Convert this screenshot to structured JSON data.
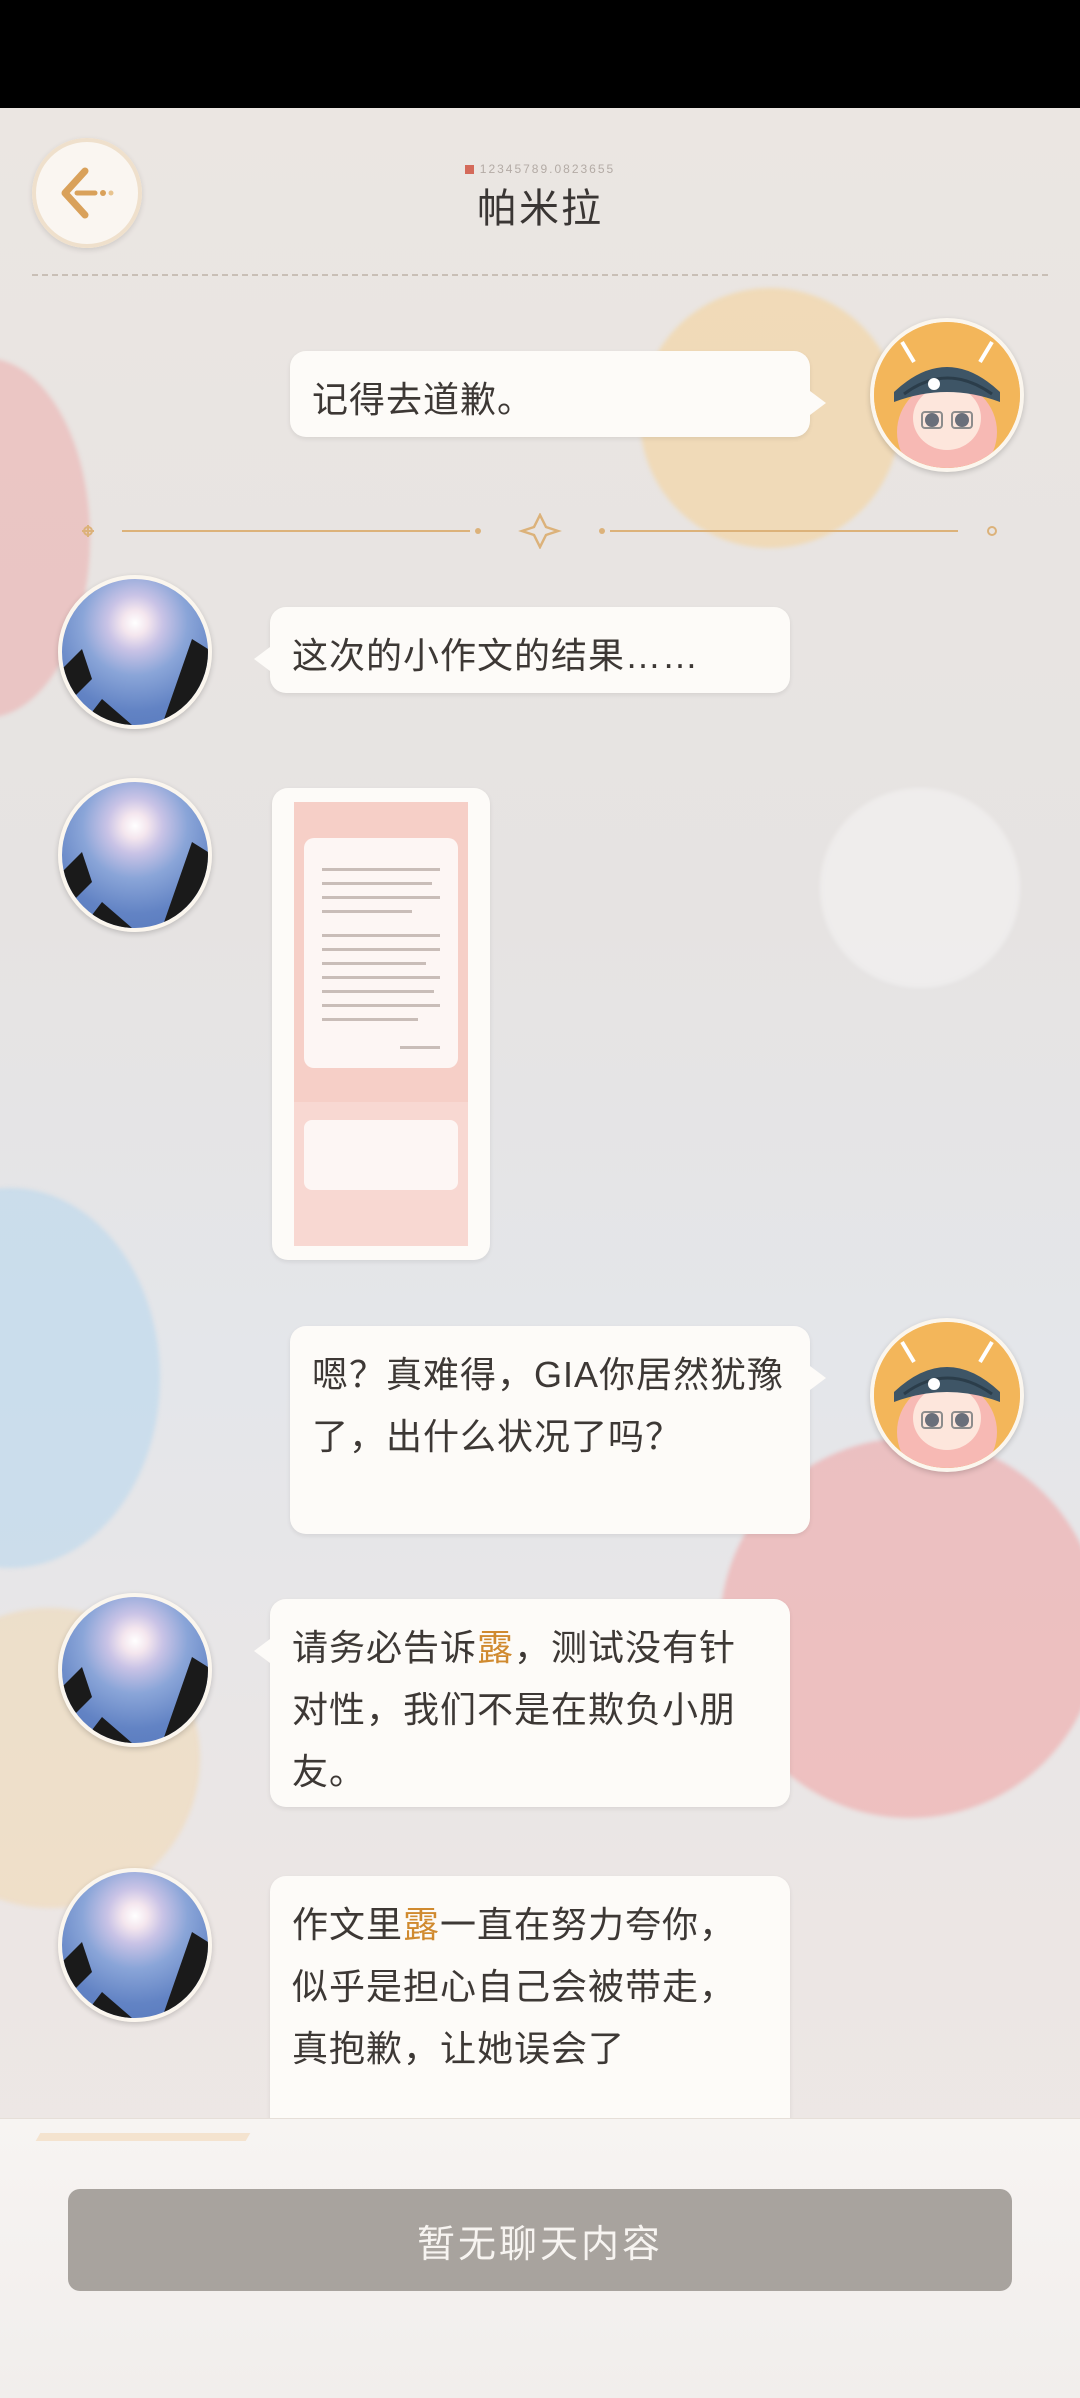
{
  "header": {
    "title": "帕米拉",
    "code": "12345789.0823655",
    "back_icon": "back-arrow-icon"
  },
  "messages": [
    {
      "side": "right",
      "speaker": "self",
      "text": "记得去道歉。"
    },
    {
      "side": "left",
      "speaker": "contact",
      "text": "这次的小作文的结果……"
    },
    {
      "side": "left",
      "speaker": "contact",
      "type": "image"
    },
    {
      "side": "right",
      "speaker": "self",
      "text": "嗯？真难得，GIA你居然犹豫了，出什么状况了吗？"
    },
    {
      "side": "left",
      "speaker": "contact",
      "text_before": "请务必告诉",
      "highlight": "露",
      "text_after": "，测试没有针对性，我们不是在欺负小朋友。"
    },
    {
      "side": "left",
      "speaker": "contact",
      "text_before": "作文里",
      "highlight": "露",
      "text_after": "一直在努力夸你，似乎是担心自己会被带走，真抱歉，让她误会了"
    }
  ],
  "bottom": {
    "no_chat_label": "暂无聊天内容"
  },
  "colors": {
    "accent": "#d08a2f",
    "divider": "#dcb27a",
    "button_bg": "#a8a39e"
  }
}
